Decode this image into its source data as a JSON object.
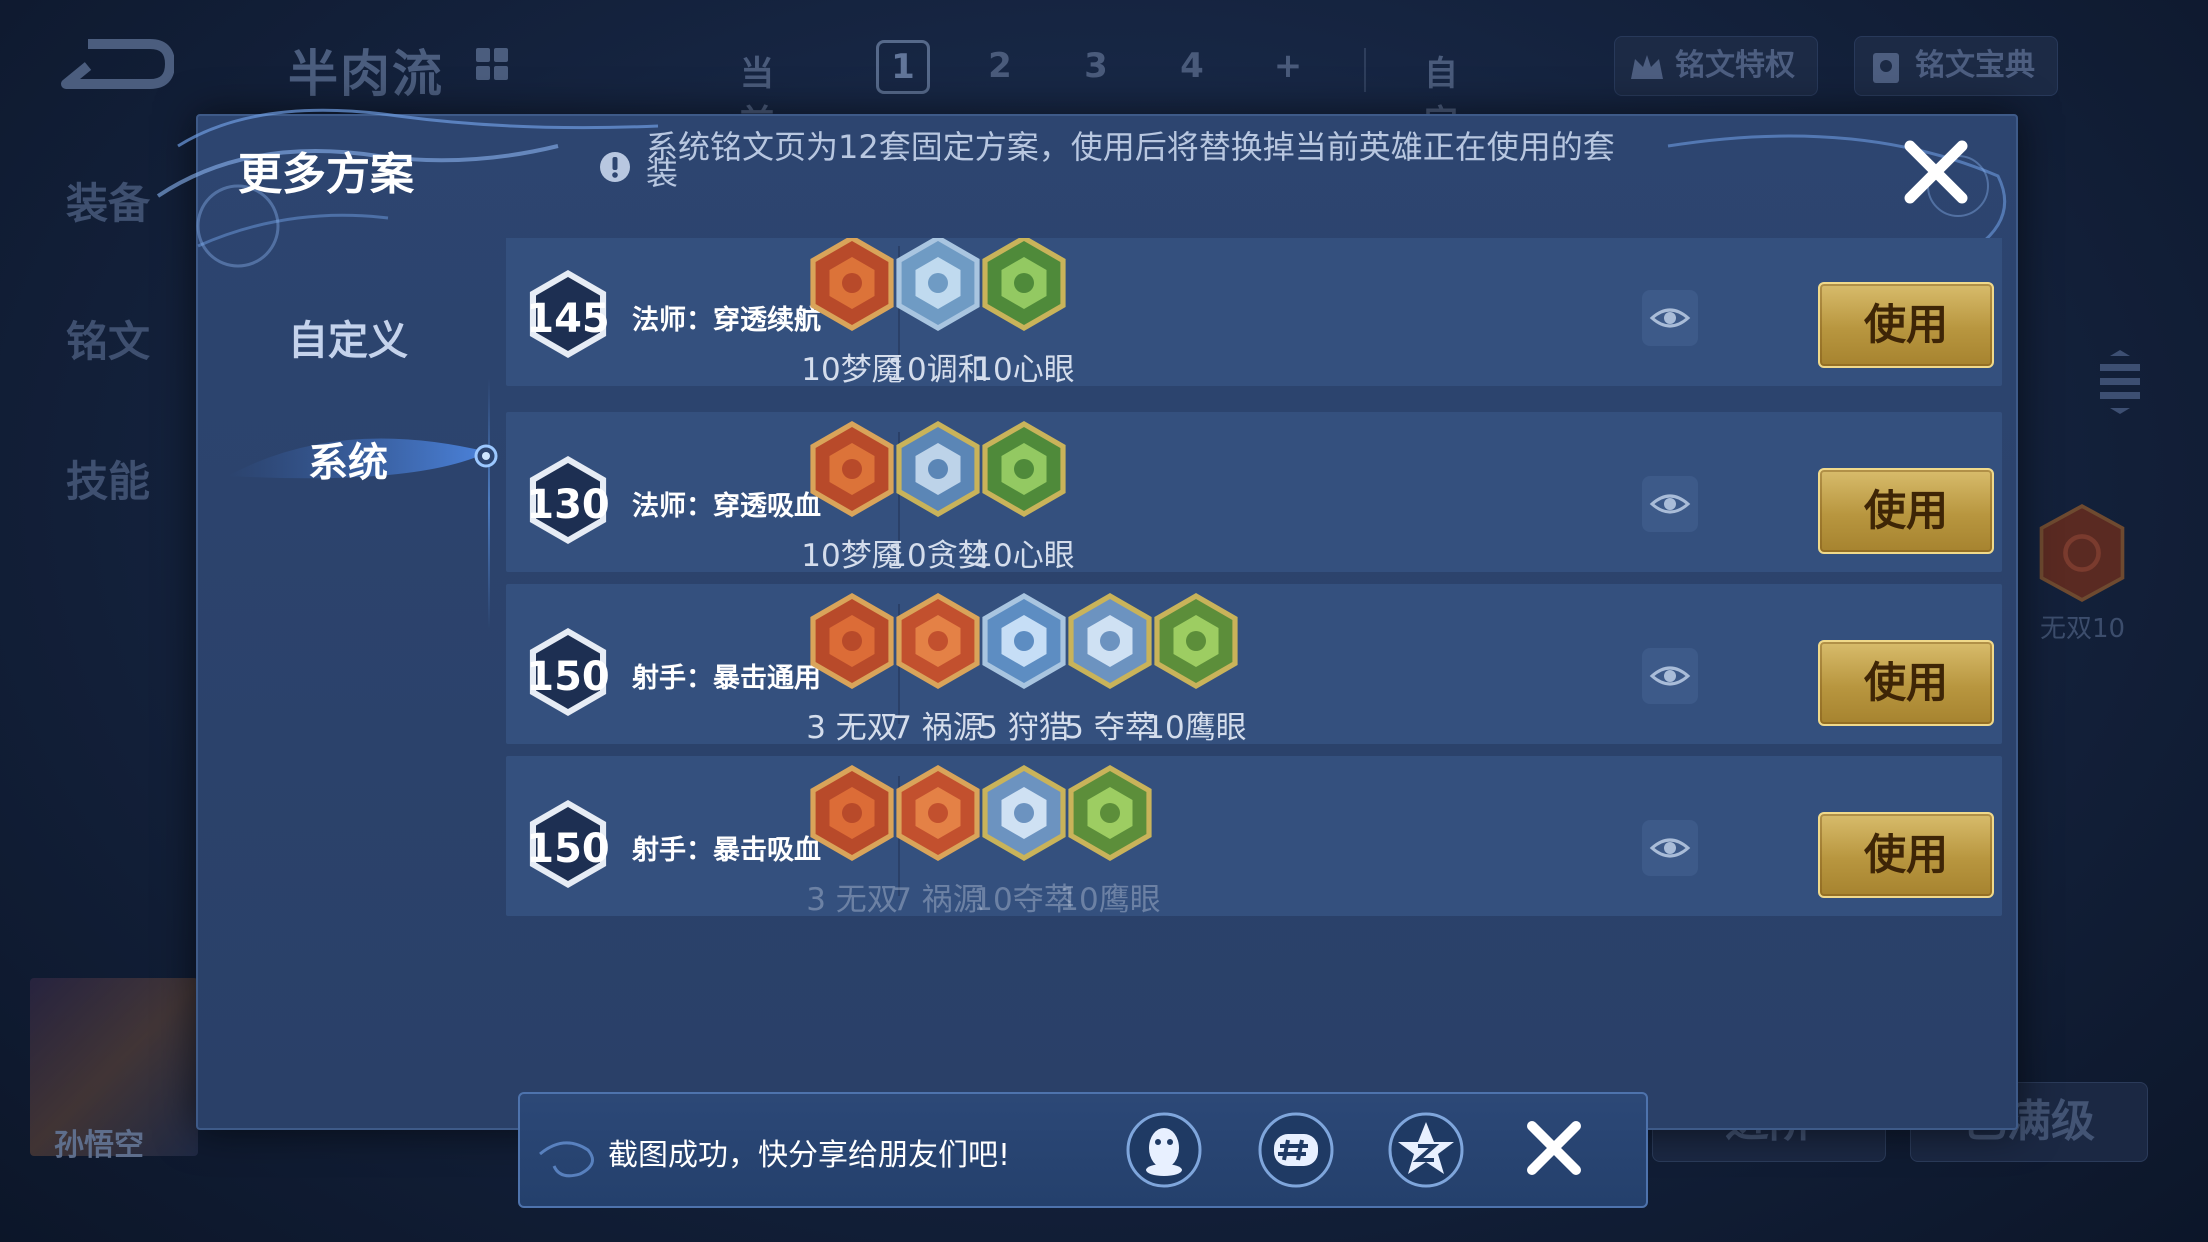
{
  "background": {
    "top_title": "半肉流",
    "tabs": {
      "current": "当前",
      "numbers": [
        "1",
        "2",
        "3",
        "4",
        "+"
      ],
      "selected": "1",
      "custom": "自定义"
    },
    "privilege_btn": "铭文特权",
    "codex_btn": "铭文宝典",
    "left_nav": [
      "装备",
      "铭文",
      "技能"
    ],
    "right_rune_label": "无双10",
    "hero_name": "孙悟空",
    "bottom_buttons": [
      "进阶",
      "已满级"
    ]
  },
  "dialog": {
    "title": "更多方案",
    "notice": "系统铭文页为12套固定方案，使用后将替换掉当前英雄正在使用的套装",
    "side_nav": {
      "custom": "自定义",
      "system": "系统"
    },
    "use_label": "使用",
    "presets": [
      {
        "level": "145",
        "name": "法师：穿透续航",
        "runes": [
          {
            "label": "10梦魇",
            "icon": "nightmare-rune"
          },
          {
            "label": "10调和",
            "icon": "harmony-rune"
          },
          {
            "label": "10心眼",
            "icon": "mind-eye-rune"
          }
        ]
      },
      {
        "level": "130",
        "name": "法师：穿透吸血",
        "runes": [
          {
            "label": "10梦魇",
            "icon": "nightmare-rune"
          },
          {
            "label": "10贪婪",
            "icon": "greed-rune"
          },
          {
            "label": "10心眼",
            "icon": "mind-eye-rune"
          }
        ]
      },
      {
        "level": "150",
        "name": "射手：暴击通用",
        "runes": [
          {
            "label": "3 无双",
            "icon": "peerless-rune"
          },
          {
            "label": "7 祸源",
            "icon": "calamity-rune"
          },
          {
            "label": "5 狩猎",
            "icon": "hunting-rune"
          },
          {
            "label": "5 夺萃",
            "icon": "seize-rune"
          },
          {
            "label": "10鹰眼",
            "icon": "eagle-eye-rune"
          }
        ]
      },
      {
        "level": "150",
        "name": "射手：暴击吸血",
        "runes": [
          {
            "label": "3 无双",
            "icon": "peerless-rune"
          },
          {
            "label": "7 祸源",
            "icon": "calamity-rune"
          },
          {
            "label": "10夺萃",
            "icon": "seize-rune"
          },
          {
            "label": "10鹰眼",
            "icon": "eagle-eye-rune"
          }
        ]
      }
    ]
  },
  "toast": {
    "message": "截图成功，快分享给朋友们吧!",
    "share_targets": [
      "qq-icon",
      "moments-icon",
      "qzone-icon"
    ]
  },
  "colors": {
    "accent_gold": "#c9a652",
    "panel": "#34507e",
    "dialog": "#2d4570"
  }
}
